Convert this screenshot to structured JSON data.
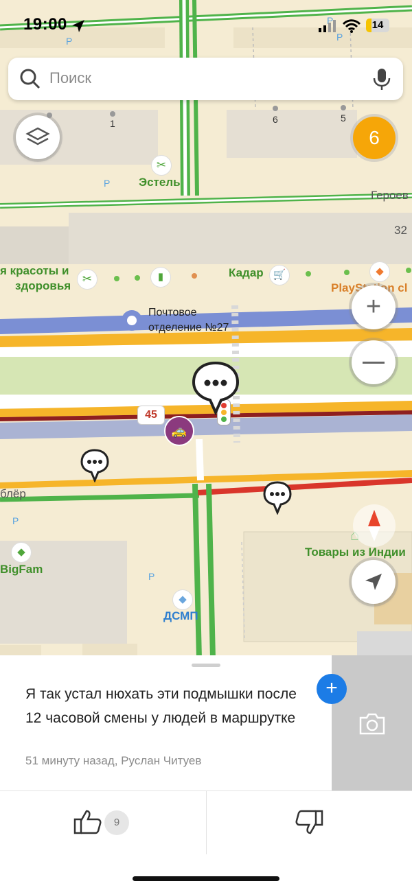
{
  "status_bar": {
    "time": "19:00",
    "battery": "14"
  },
  "search": {
    "placeholder": "Поиск"
  },
  "map": {
    "traffic_badge": "6",
    "speed_limit": "45",
    "house_numbers": [
      "1",
      "6",
      "5"
    ],
    "street_partial_top": "Героев",
    "house_32": "32",
    "street_left": "блёр",
    "parking": "P",
    "pois": {
      "estel": "Эстель",
      "beauty_line1": "я красоты и",
      "beauty_line2": "здоровья",
      "kadar": "Кадар",
      "playstation": "PlayStation cl",
      "post_office_line1": "Почтовое",
      "post_office_line2": "отделение №27",
      "goods_india": "Товары из Индии",
      "bigfam": "BigFam",
      "dsmp": "ДСМП"
    },
    "colors": {
      "road_green": "#4fb34a",
      "road_orange": "#f6b52a",
      "road_red": "#d9362b",
      "route_blue": "#7b8fd4"
    }
  },
  "report": {
    "text": "Я так устал нюхать эти подмышки после 12 часовой смены у людей в маршрутке",
    "meta": "51 минуту назад, Руслан Читуев",
    "likes": "9"
  }
}
